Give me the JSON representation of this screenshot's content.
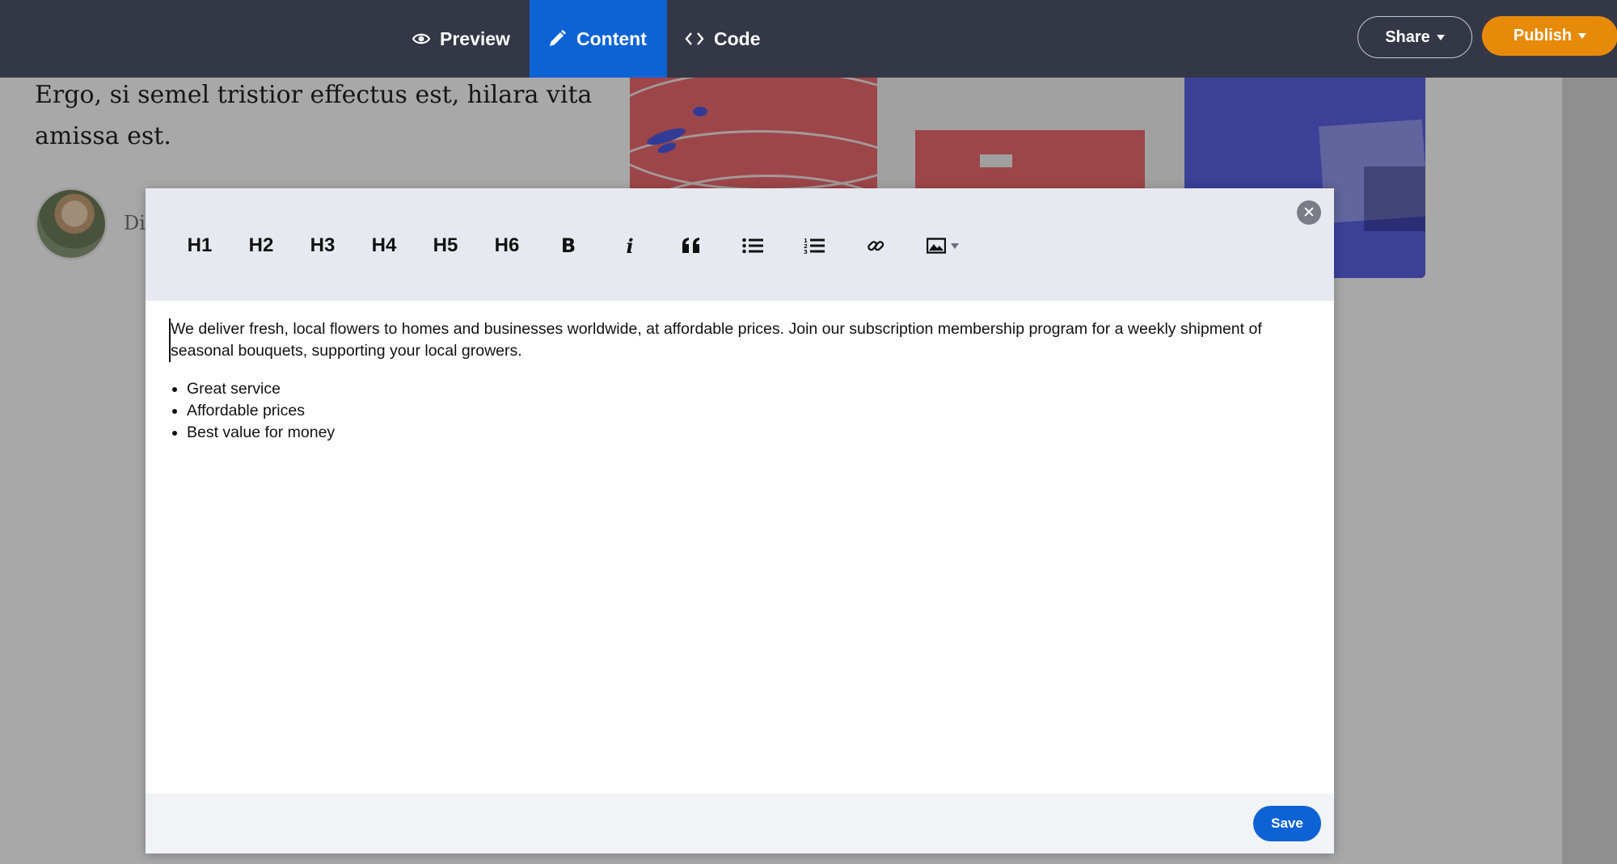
{
  "background": {
    "article_text": "Ergo, si semel tristior effectus est, hilara vita amissa est.",
    "author_initial": "Di"
  },
  "topbar": {
    "tabs": [
      {
        "label": "Preview",
        "icon": "eye-icon",
        "active": false
      },
      {
        "label": "Content",
        "icon": "pencil-icon",
        "active": true
      },
      {
        "label": "Code",
        "icon": "code-icon",
        "active": false
      }
    ],
    "share_label": "Share",
    "publish_label": "Publish",
    "accent_color": "#0d63d6",
    "publish_color": "#e88a09"
  },
  "toolbar": {
    "headings": [
      "H1",
      "H2",
      "H3",
      "H4",
      "H5",
      "H6"
    ],
    "bold_label": "B",
    "italic_label": "i",
    "icons": [
      "bold-icon",
      "italic-icon",
      "blockquote-icon",
      "bullet-list-icon",
      "numbered-list-icon",
      "link-icon",
      "image-icon"
    ]
  },
  "editor": {
    "paragraph": "We deliver fresh, local flowers to homes and businesses worldwide, at affordable prices. Join our subscription membership program for a weekly shipment of seasonal bouquets, supporting your local growers.",
    "bullets": [
      "Great service",
      "Affordable prices",
      "Best value for money"
    ]
  },
  "footer": {
    "save_label": "Save"
  }
}
